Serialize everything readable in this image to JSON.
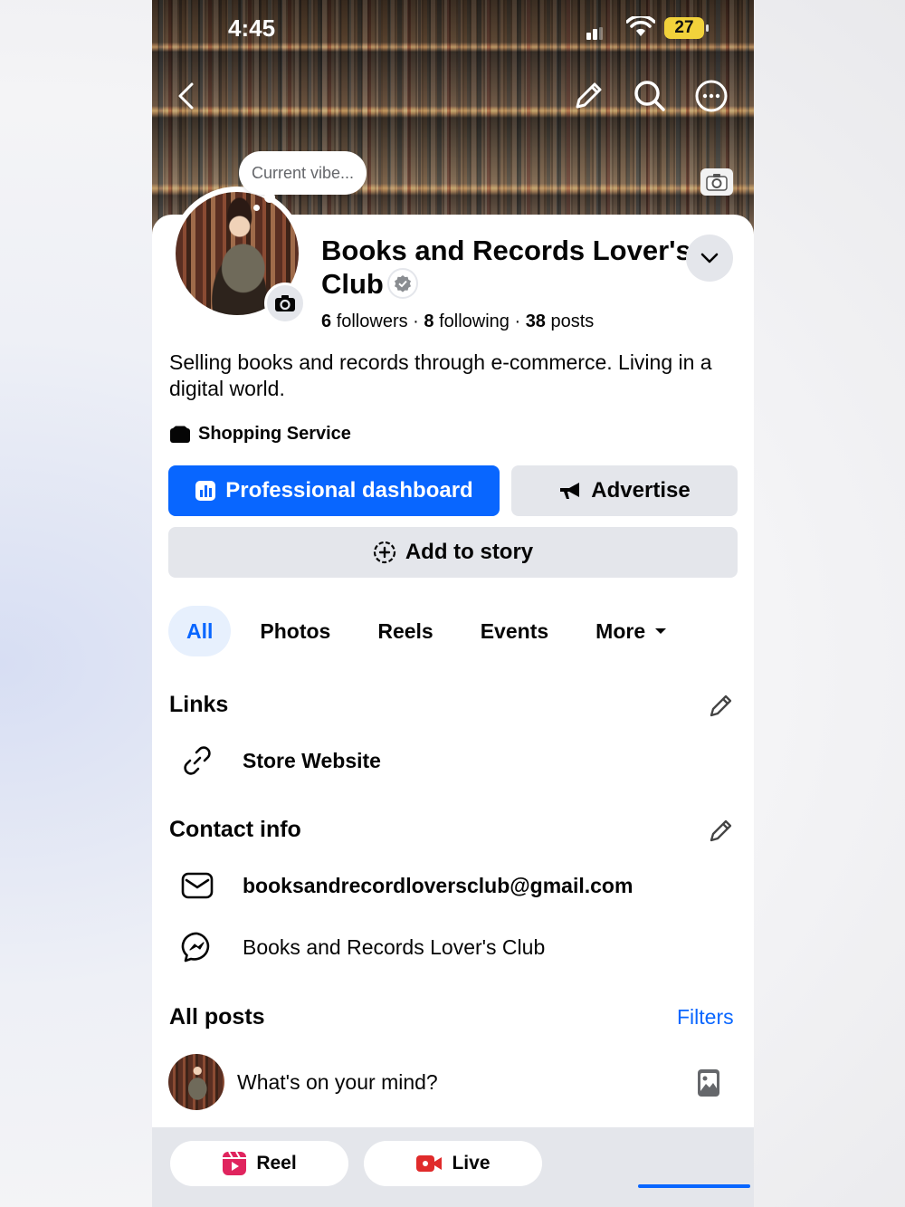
{
  "status_bar": {
    "time": "4:45",
    "battery": "27"
  },
  "profile": {
    "vibe_bubble": "Current vibe...",
    "name": "Books and Records Lover's Club",
    "stats": {
      "followers_count": "6",
      "followers_label": "followers",
      "following_count": "8",
      "following_label": "following",
      "posts_count": "38",
      "posts_label": "posts"
    },
    "bio": "Selling books and records through e-commerce. Living in a digital world.",
    "category": "Shopping Service"
  },
  "buttons": {
    "dashboard": "Professional dashboard",
    "advertise": "Advertise",
    "add_story": "Add to story"
  },
  "tabs": [
    "All",
    "Photos",
    "Reels",
    "Events",
    "More"
  ],
  "links": {
    "title": "Links",
    "items": [
      "Store Website"
    ]
  },
  "contact": {
    "title": "Contact info",
    "email": "booksandrecordloversclub@gmail.com",
    "messenger": "Books and Records Lover's Club"
  },
  "posts": {
    "title": "All posts",
    "filters": "Filters",
    "composer_placeholder": "What's on your mind?"
  },
  "bottom": {
    "reel": "Reel",
    "live": "Live"
  },
  "colors": {
    "accent": "#0866ff",
    "button_gray": "#e4e6eb",
    "tab_active_bg": "#e7f0fd"
  }
}
